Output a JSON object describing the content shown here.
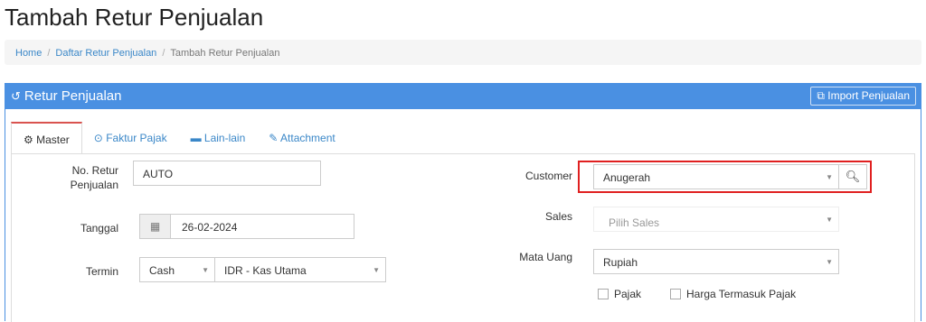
{
  "page": {
    "title": "Tambah Retur Penjualan"
  },
  "breadcrumb": {
    "items": [
      "Home",
      "Daftar Retur Penjualan",
      "Tambah Retur Penjualan"
    ],
    "separator": "/"
  },
  "panel": {
    "title": "Retur Penjualan",
    "import_label": "Import Penjualan",
    "accent": "#4a90e2"
  },
  "tabs": [
    "Master",
    "Faktur Pajak",
    "Lain-lain",
    "Attachment"
  ],
  "form": {
    "no_retur_label": "No. Retur Penjualan",
    "no_retur_value": "AUTO",
    "tanggal_label": "Tanggal",
    "tanggal_value": "26-02-2024",
    "termin_label": "Termin",
    "termin_value": "Cash",
    "kas_value": "IDR - Kas Utama",
    "customer_label": "Customer",
    "customer_value": "Anugerah",
    "sales_label": "Sales",
    "sales_placeholder": "Pilih Sales",
    "mata_uang_label": "Mata Uang",
    "mata_uang_value": "Rupiah",
    "pajak_label": "Pajak",
    "harga_termasuk_pajak_label": "Harga Termasuk Pajak"
  }
}
